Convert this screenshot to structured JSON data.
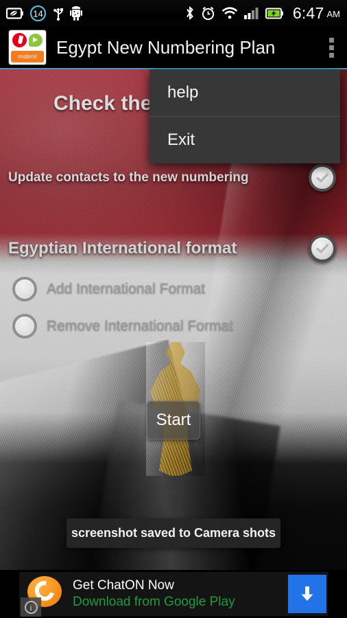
{
  "statusbar": {
    "time": "6:47",
    "ampm": "AM",
    "left_icons": [
      {
        "name": "power-saving-battery-icon",
        "glyph": "battery-leaf"
      },
      {
        "name": "notification-count-badge",
        "glyph": "circle-number",
        "value": "14"
      },
      {
        "name": "usb-icon",
        "glyph": "usb"
      },
      {
        "name": "android-debug-icon",
        "glyph": "android-robot"
      }
    ],
    "right_icons": [
      {
        "name": "bluetooth-icon",
        "glyph": "bluetooth"
      },
      {
        "name": "alarm-clock-icon",
        "glyph": "alarm"
      },
      {
        "name": "wifi-icon",
        "glyph": "wifi"
      },
      {
        "name": "cellular-signal-icon",
        "glyph": "signal-bars"
      },
      {
        "name": "battery-charging-icon",
        "glyph": "battery-charging"
      }
    ]
  },
  "titlebar": {
    "title": "Egypt New Numbering Plan",
    "logo_text": "mobinil"
  },
  "menu": {
    "items": [
      {
        "label": "help"
      },
      {
        "label": "Exit"
      }
    ]
  },
  "main": {
    "headline": "Check the",
    "update_contacts": {
      "label": "Update contacts to the new numbering",
      "checked": false
    },
    "international_format": {
      "label": "Egyptian International format",
      "checked": false
    },
    "radios": [
      {
        "label": "Add International Format",
        "selected": false
      },
      {
        "label": "Remove International Format",
        "selected": false
      }
    ],
    "start_button": "Start",
    "toast": "screenshot saved to Camera shots"
  },
  "ad": {
    "line1": "Get ChatON Now",
    "line2": "Download from Google Play",
    "info_glyph": "i"
  },
  "colors": {
    "flag_red": "#8C2028",
    "flag_white": "#C8C8C8",
    "flag_black": "#0A0A0A",
    "eagle_gold": "#D6A01E",
    "title_accent": "#3F9FC4",
    "menu_bg": "#373737",
    "ad_green": "#1F9C3D",
    "ad_blue": "#2272E8",
    "chaton_orange": "#F7941E"
  }
}
